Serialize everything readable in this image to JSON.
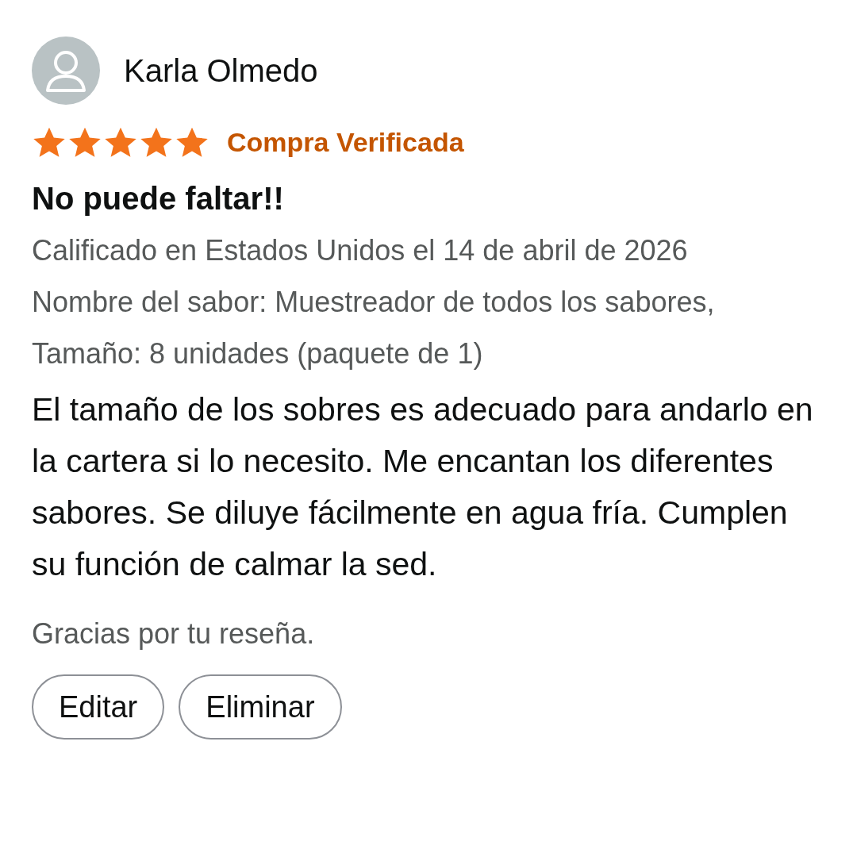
{
  "reviewer": {
    "name": "Karla Olmedo"
  },
  "rating": {
    "stars": 5,
    "badge": "Compra Verificada"
  },
  "title": "No puede faltar!!",
  "meta": [
    "Calificado en Estados Unidos el 14 de abril de 2026",
    "Nombre del sabor: Muestreador de todos los sabores, Tamaño: 8 unidades (paquete de 1)"
  ],
  "body": "El tamaño de los sobres es adecuado para andarlo en la cartera si lo necesito. Me encantan los diferentes sabores. Se diluye fácilmente en agua fría. Cumplen su función de calmar la sed.",
  "thanks": "Gracias por tu reseña.",
  "buttons": [
    "Editar",
    "Eliminar"
  ]
}
